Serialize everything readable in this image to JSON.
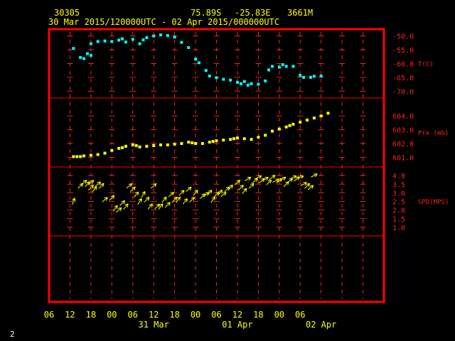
{
  "header": {
    "station": "30305",
    "lat": "75.89S",
    "lon": "-25.83E",
    "elev": "3661M",
    "period": "30 Mar 2015/120000UTC - 02 Apr 2015/000000UTC"
  },
  "footer": {
    "page_number": "2"
  },
  "colors": {
    "frame": "#ff0000",
    "grid": "#ff2020",
    "axis_text": "#ffff00",
    "temperature": "#00ffff",
    "pressure": "#ffff00",
    "wind": "#ffff00",
    "panel_text": "#ff2020"
  },
  "chart_data": {
    "type": "scatter",
    "x_axis": {
      "range_hours": [
        -6,
        90
      ],
      "tick_labels": [
        "06",
        "12",
        "18",
        "00",
        "06",
        "12",
        "18",
        "00",
        "06",
        "12",
        "18",
        "00",
        "06"
      ],
      "date_labels": [
        {
          "hour": 24,
          "label": "31 Mar"
        },
        {
          "hour": 48,
          "label": "01 Apr"
        },
        {
          "hour": 72,
          "label": "02 Apr"
        }
      ]
    },
    "panels": [
      {
        "name": "temperature",
        "label": "T(C)",
        "ylim": [
          -72.5,
          -47.5
        ],
        "ticks": [
          "-50.0",
          "-55.0",
          "-60.0",
          "-65.0",
          "-70.0"
        ],
        "tick_values": [
          -50,
          -55,
          -60,
          -65,
          -70
        ],
        "x": [
          1,
          3,
          4,
          5,
          6,
          6,
          8,
          10,
          12,
          14,
          15,
          16,
          18,
          20,
          21,
          22,
          24,
          26,
          28,
          30,
          32,
          34,
          36,
          37,
          39,
          40,
          42,
          44,
          46,
          48,
          49,
          50,
          51,
          52,
          54,
          56,
          57,
          58,
          60,
          61,
          62,
          64,
          66,
          67,
          69,
          70,
          72
        ],
        "y": [
          -54.5,
          -57.8,
          -58.2,
          -56.4,
          -57.0,
          -52.8,
          -52.0,
          -51.8,
          -52.0,
          -51.5,
          -51.0,
          -52.2,
          -51.2,
          -52.8,
          -51.4,
          -50.6,
          -50.0,
          -49.6,
          -49.8,
          -50.4,
          -52.3,
          -54.2,
          -58.4,
          -59.7,
          -62.5,
          -64.5,
          -65.1,
          -65.7,
          -66.0,
          -66.8,
          -67.3,
          -66.5,
          -67.8,
          -67.3,
          -67.5,
          -66.3,
          -62.3,
          -61.0,
          -61.3,
          -60.4,
          -61.0,
          -61.0,
          -64.3,
          -65.0,
          -65.0,
          -64.6,
          -64.5
        ]
      },
      {
        "name": "pressure",
        "label": "Pre (mb)",
        "ylim": [
          600.3,
          605.3
        ],
        "ticks": [
          "604.0",
          "603.0",
          "602.0",
          "601.0"
        ],
        "tick_values": [
          604,
          603,
          602,
          601
        ],
        "x": [
          1,
          2,
          3,
          4,
          6,
          8,
          10,
          12,
          14,
          15,
          16,
          18,
          19,
          20,
          22,
          24,
          26,
          28,
          30,
          32,
          34,
          35,
          36,
          38,
          40,
          41,
          42,
          44,
          46,
          47,
          48,
          50,
          52,
          54,
          56,
          58,
          60,
          62,
          63,
          64,
          66,
          68,
          70,
          72,
          74
        ],
        "y": [
          601.05,
          601.05,
          601.05,
          601.1,
          601.15,
          601.2,
          601.3,
          601.5,
          601.65,
          601.7,
          601.8,
          601.9,
          601.85,
          601.75,
          601.8,
          601.85,
          601.9,
          601.9,
          601.95,
          602.0,
          602.1,
          602.05,
          602.0,
          602.0,
          602.1,
          602.15,
          602.2,
          602.25,
          602.3,
          602.35,
          602.4,
          602.35,
          602.3,
          602.45,
          602.6,
          602.9,
          603.05,
          603.2,
          603.3,
          603.4,
          603.55,
          603.7,
          603.85,
          604.0,
          604.2
        ]
      },
      {
        "name": "wind",
        "label": "SPD(MPS)",
        "ylim": [
          0.5,
          4.5
        ],
        "ticks": [
          "4.0",
          "3.5",
          "3.0",
          "2.5",
          "2.0",
          "1.5",
          "1.0"
        ],
        "tick_values": [
          4,
          3.5,
          3,
          2.5,
          2,
          1.5,
          1
        ],
        "x": [
          1,
          3,
          4,
          5,
          6,
          6,
          7,
          8,
          9,
          10,
          12,
          13,
          14,
          15,
          16,
          17,
          18,
          19,
          20,
          21,
          22,
          23,
          24,
          25,
          26,
          27,
          28,
          29,
          30,
          31,
          32,
          33,
          34,
          35,
          36,
          38,
          39,
          40,
          41,
          42,
          43,
          44,
          45,
          46,
          48,
          49,
          50,
          51,
          52,
          53,
          54,
          55,
          56,
          57,
          58,
          59,
          60,
          61,
          62,
          63,
          64,
          65,
          66,
          67,
          68,
          69,
          70
        ],
        "y": [
          2.5,
          3.4,
          3.6,
          3.5,
          3.3,
          3.6,
          3.2,
          3.5,
          3.4,
          2.6,
          2.7,
          2.1,
          2.0,
          2.4,
          2.2,
          3.4,
          3.2,
          2.9,
          2.5,
          2.9,
          2.6,
          2.2,
          3.4,
          2.2,
          2.2,
          2.6,
          2.3,
          2.9,
          2.6,
          2.6,
          3.0,
          2.5,
          3.2,
          2.6,
          3.0,
          2.8,
          2.9,
          3.0,
          2.6,
          2.9,
          3.0,
          2.9,
          3.2,
          3.3,
          3.6,
          3.3,
          3.1,
          3.8,
          3.4,
          3.7,
          3.9,
          3.7,
          3.8,
          3.6,
          3.9,
          3.7,
          3.7,
          3.8,
          3.5,
          3.7,
          3.9,
          3.8,
          3.9,
          3.5,
          3.4,
          3.3,
          4.0
        ],
        "dir_deg": [
          70,
          45,
          40,
          50,
          45,
          35,
          50,
          40,
          45,
          40,
          45,
          55,
          40,
          45,
          50,
          40,
          45,
          50,
          55,
          60,
          45,
          50,
          40,
          45,
          55,
          50,
          45,
          40,
          50,
          55,
          45,
          50,
          40,
          45,
          50,
          45,
          40,
          50,
          55,
          45,
          50,
          40,
          45,
          50,
          40,
          45,
          50,
          30,
          45,
          40,
          25,
          40,
          30,
          45,
          35,
          25,
          40,
          30,
          45,
          35,
          25,
          40,
          20,
          30,
          45,
          40,
          25
        ]
      }
    ]
  }
}
